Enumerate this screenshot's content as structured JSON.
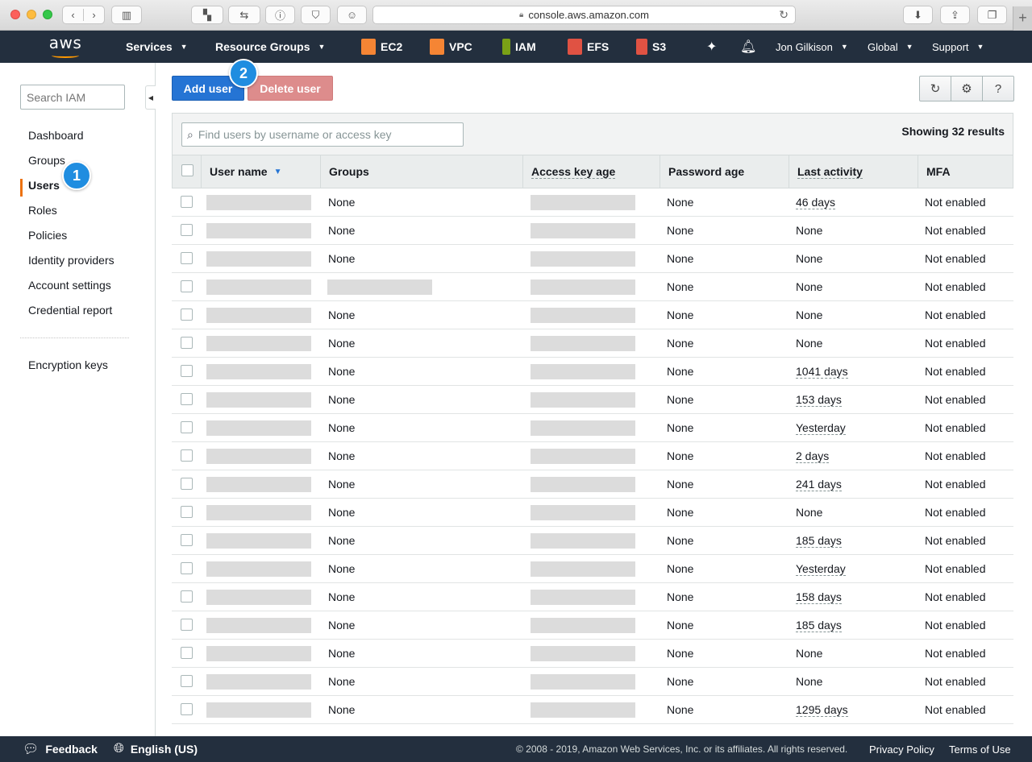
{
  "browser": {
    "url": "console.aws.amazon.com"
  },
  "nav": {
    "logo_text": "aws",
    "services": "Services",
    "resource_groups": "Resource Groups",
    "shortcuts": [
      {
        "label": "EC2",
        "color": "#f58534"
      },
      {
        "label": "VPC",
        "color": "#f58534"
      },
      {
        "label": "IAM",
        "color": "#7aa116"
      },
      {
        "label": "EFS",
        "color": "#e05243"
      },
      {
        "label": "S3",
        "color": "#e05243"
      }
    ],
    "user": "Jon Gilkison",
    "region": "Global",
    "support": "Support"
  },
  "sidebar": {
    "search_placeholder": "Search IAM",
    "links": [
      "Dashboard",
      "Groups",
      "Users",
      "Roles",
      "Policies",
      "Identity providers",
      "Account settings",
      "Credential report"
    ],
    "active": "Users",
    "encryption": "Encryption keys"
  },
  "annotations": {
    "one": "1",
    "two": "2"
  },
  "toolbar": {
    "add_user": "Add user",
    "delete_user": "Delete user"
  },
  "table": {
    "find_placeholder": "Find users by username or access key",
    "showing": "Showing 32 results",
    "columns": [
      "User name",
      "Groups",
      "Access key age",
      "Password age",
      "Last activity",
      "MFA"
    ],
    "rows": [
      {
        "groups": "None",
        "password_age": "None",
        "last_activity": "46 days",
        "mfa": "Not enabled"
      },
      {
        "groups": "None",
        "password_age": "None",
        "last_activity": "None",
        "mfa": "Not enabled"
      },
      {
        "groups": "None",
        "password_age": "None",
        "last_activity": "None",
        "mfa": "Not enabled"
      },
      {
        "groups": "",
        "password_age": "None",
        "last_activity": "None",
        "mfa": "Not enabled"
      },
      {
        "groups": "None",
        "password_age": "None",
        "last_activity": "None",
        "mfa": "Not enabled"
      },
      {
        "groups": "None",
        "password_age": "None",
        "last_activity": "None",
        "mfa": "Not enabled"
      },
      {
        "groups": "None",
        "password_age": "None",
        "last_activity": "1041 days",
        "mfa": "Not enabled"
      },
      {
        "groups": "None",
        "password_age": "None",
        "last_activity": "153 days",
        "mfa": "Not enabled"
      },
      {
        "groups": "None",
        "password_age": "None",
        "last_activity": "Yesterday",
        "mfa": "Not enabled"
      },
      {
        "groups": "None",
        "password_age": "None",
        "last_activity": "2 days",
        "mfa": "Not enabled"
      },
      {
        "groups": "None",
        "password_age": "None",
        "last_activity": "241 days",
        "mfa": "Not enabled"
      },
      {
        "groups": "None",
        "password_age": "None",
        "last_activity": "None",
        "mfa": "Not enabled"
      },
      {
        "groups": "None",
        "password_age": "None",
        "last_activity": "185 days",
        "mfa": "Not enabled"
      },
      {
        "groups": "None",
        "password_age": "None",
        "last_activity": "Yesterday",
        "mfa": "Not enabled"
      },
      {
        "groups": "None",
        "password_age": "None",
        "last_activity": "158 days",
        "mfa": "Not enabled"
      },
      {
        "groups": "None",
        "password_age": "None",
        "last_activity": "185 days",
        "mfa": "Not enabled"
      },
      {
        "groups": "None",
        "password_age": "None",
        "last_activity": "None",
        "mfa": "Not enabled"
      },
      {
        "groups": "None",
        "password_age": "None",
        "last_activity": "None",
        "mfa": "Not enabled"
      },
      {
        "groups": "None",
        "password_age": "None",
        "last_activity": "1295 days",
        "mfa": "Not enabled"
      }
    ]
  },
  "footer": {
    "feedback": "Feedback",
    "language": "English (US)",
    "copyright": "© 2008 - 2019, Amazon Web Services, Inc. or its affiliates. All rights reserved.",
    "privacy": "Privacy Policy",
    "terms": "Terms of Use"
  }
}
